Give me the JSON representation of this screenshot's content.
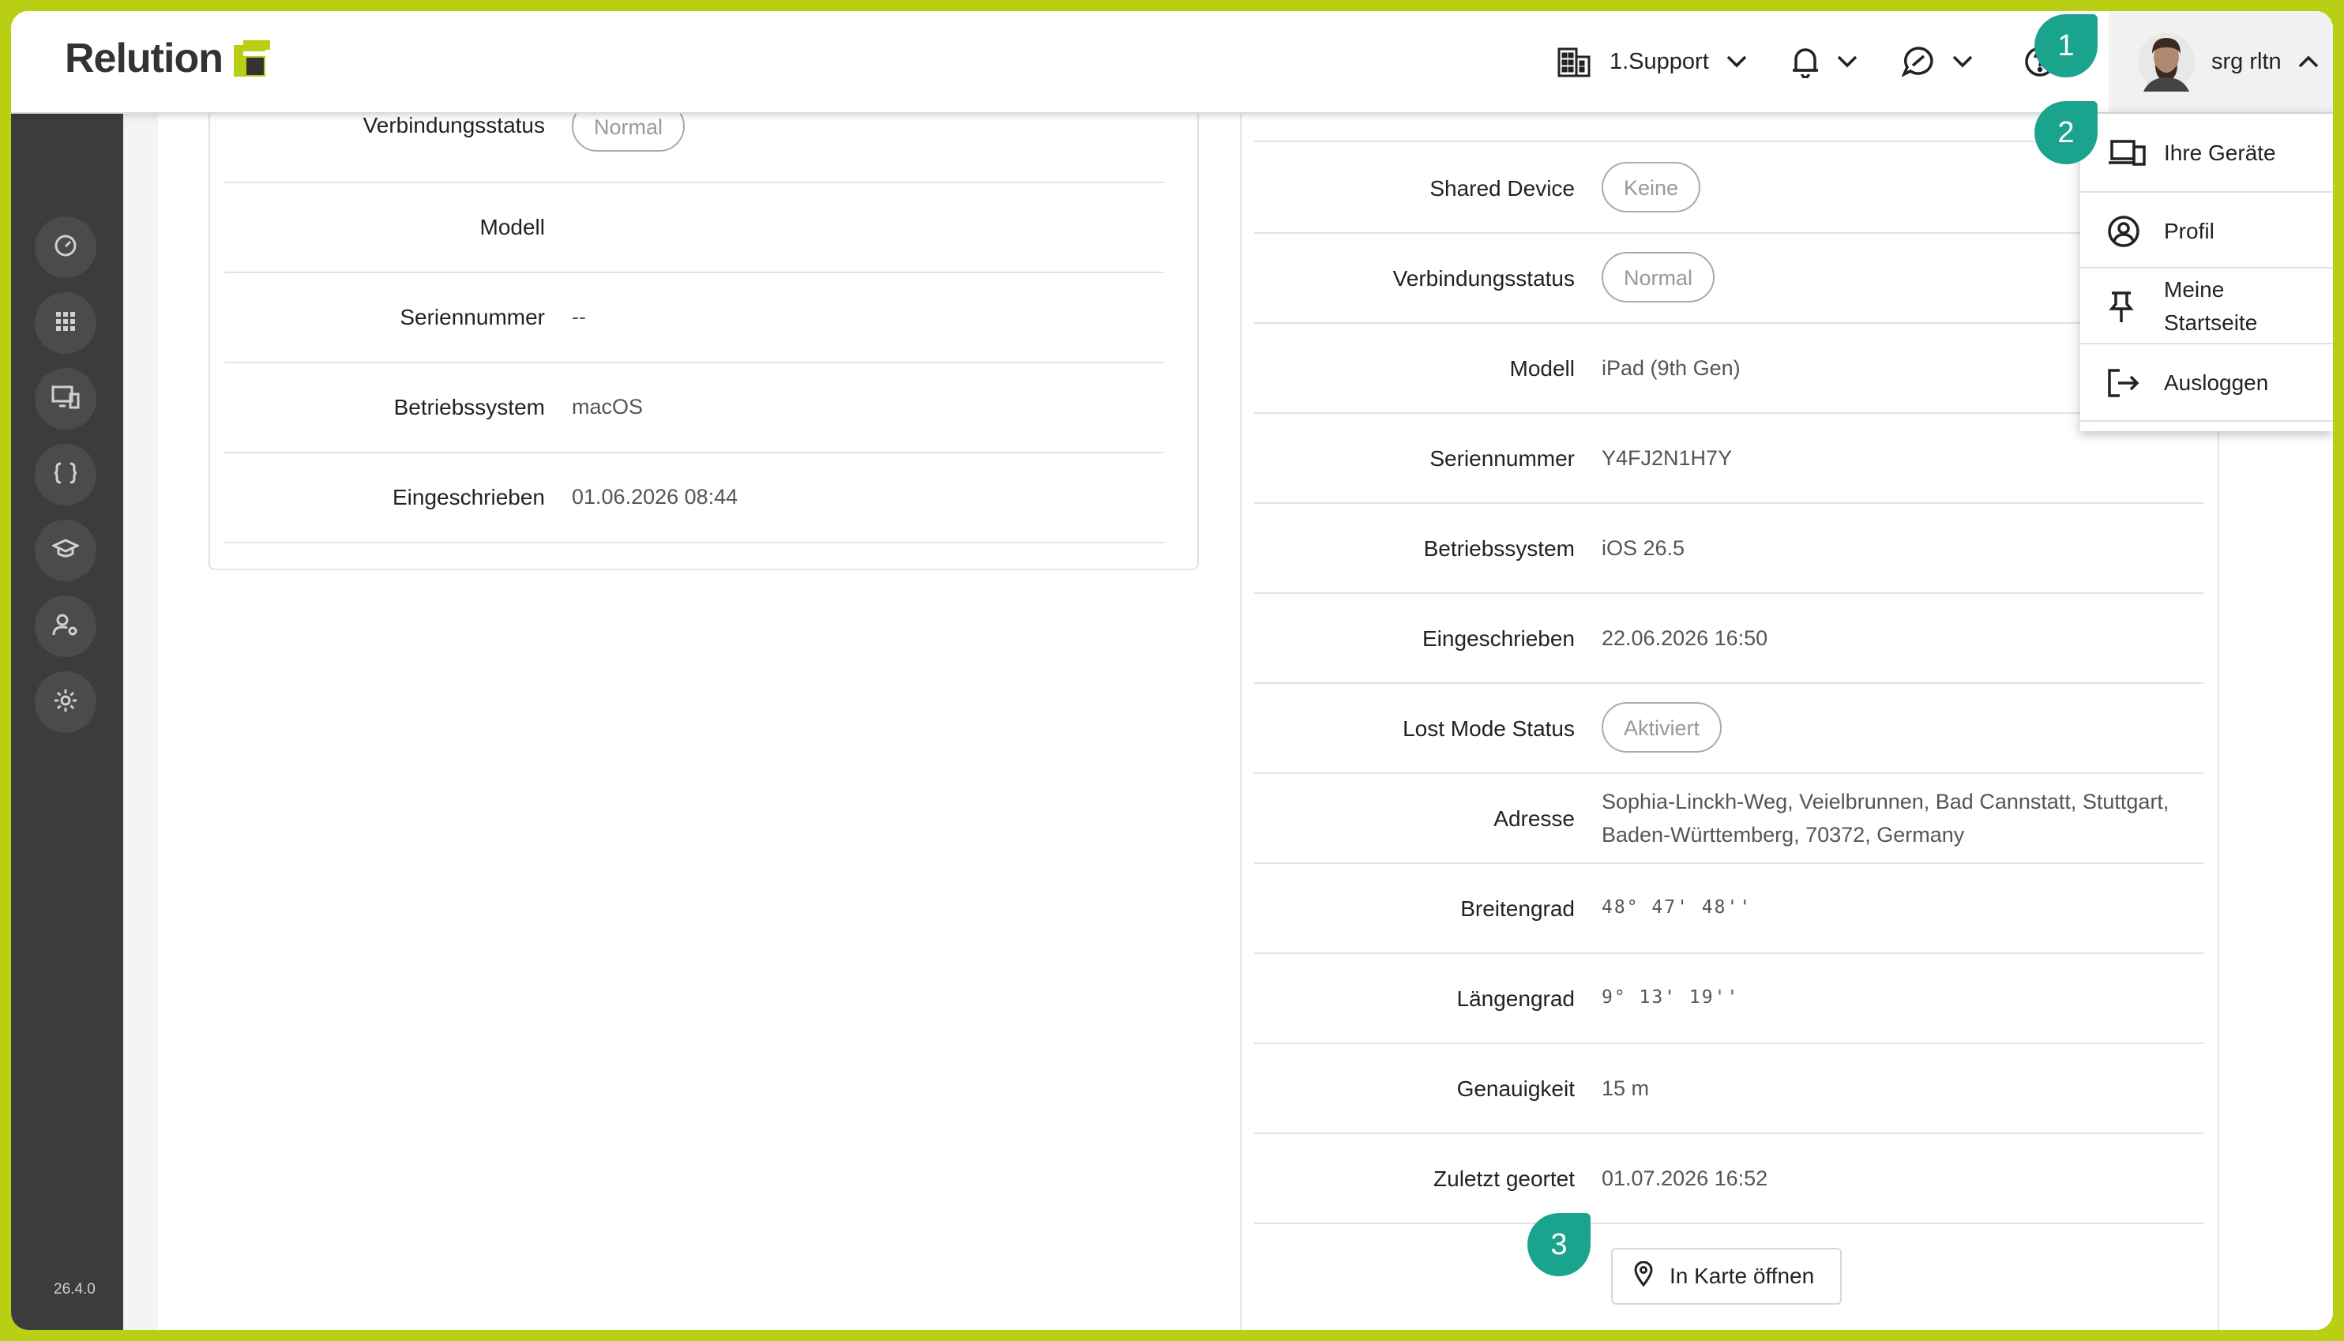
{
  "app": {
    "logo_text": "Relution",
    "version": "26.4.0"
  },
  "header": {
    "org_label": "1.Support",
    "user_name": "srg rltn"
  },
  "sidebar": {
    "items": [
      {
        "name": "dashboard",
        "icon": "speedometer-icon"
      },
      {
        "name": "apps",
        "icon": "grid-icon"
      },
      {
        "name": "devices",
        "icon": "devices-icon"
      },
      {
        "name": "policies",
        "icon": "braces-icon"
      },
      {
        "name": "education",
        "icon": "graduation-cap-icon"
      },
      {
        "name": "users",
        "icon": "user-settings-icon"
      },
      {
        "name": "settings",
        "icon": "gear-icon"
      }
    ]
  },
  "left_card": {
    "rows": [
      {
        "label": "Verbindungsstatus",
        "pill": "Normal"
      },
      {
        "label": "Modell",
        "value": ""
      },
      {
        "label": "Seriennummer",
        "value": "--"
      },
      {
        "label": "Betriebssystem",
        "value": "macOS"
      },
      {
        "label": "Eingeschrieben",
        "value": "01.06.2026 08:44"
      }
    ]
  },
  "right_card": {
    "rows": [
      {
        "label": "Shared Device",
        "pill": "Keine"
      },
      {
        "label": "Verbindungsstatus",
        "pill": "Normal"
      },
      {
        "label": "Modell",
        "value": "iPad (9th Gen)"
      },
      {
        "label": "Seriennummer",
        "value": "Y4FJ2N1H7Y"
      },
      {
        "label": "Betriebssystem",
        "value": "iOS 26.5"
      },
      {
        "label": "Eingeschrieben",
        "value": "22.06.2026 16:50"
      },
      {
        "label": "Lost Mode Status",
        "pill": "Aktiviert"
      },
      {
        "label": "Adresse",
        "value_line1": "Sophia-Linckh-Weg, Veielbrunnen, Bad Cannstatt, Stuttgart,",
        "value_line2": "Baden-Württemberg, 70372, Germany"
      },
      {
        "label": "Breitengrad",
        "value": "48° 47' 48''"
      },
      {
        "label": "Längengrad",
        "value": "9° 13' 19''"
      },
      {
        "label": "Genauigkeit",
        "value": "15 m"
      },
      {
        "label": "Zuletzt geortet",
        "value": "01.07.2026 16:52"
      }
    ],
    "map_button": "In Karte öffnen"
  },
  "user_menu": {
    "items": [
      {
        "label": "Ihre Geräte",
        "icon": "devices-icon"
      },
      {
        "label": "Profil",
        "icon": "user-circle-icon"
      },
      {
        "label_line1": "Meine",
        "label_line2": "Startseite",
        "icon": "pin-icon"
      },
      {
        "label": "Ausloggen",
        "icon": "logout-icon"
      }
    ]
  },
  "badges": [
    "1",
    "2",
    "3"
  ],
  "colors": {
    "accent": "#b9cf14",
    "badge": "#1aa48e",
    "sidebar": "#3c3c3c"
  }
}
